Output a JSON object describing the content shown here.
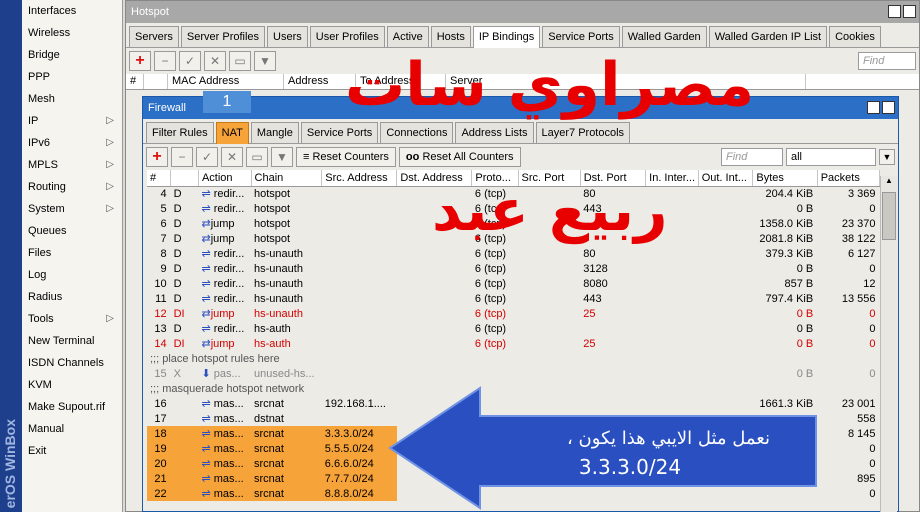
{
  "sidebar": {
    "brand": "erOS WinBox",
    "items": [
      {
        "label": "Interfaces",
        "arrow": false
      },
      {
        "label": "Wireless",
        "arrow": false
      },
      {
        "label": "Bridge",
        "arrow": false
      },
      {
        "label": "PPP",
        "arrow": false
      },
      {
        "label": "Mesh",
        "arrow": false
      },
      {
        "label": "IP",
        "arrow": true
      },
      {
        "label": "IPv6",
        "arrow": true
      },
      {
        "label": "MPLS",
        "arrow": true
      },
      {
        "label": "Routing",
        "arrow": true
      },
      {
        "label": "System",
        "arrow": true
      },
      {
        "label": "Queues",
        "arrow": false
      },
      {
        "label": "Files",
        "arrow": false
      },
      {
        "label": "Log",
        "arrow": false
      },
      {
        "label": "Radius",
        "arrow": false
      },
      {
        "label": "Tools",
        "arrow": true
      },
      {
        "label": "New Terminal",
        "arrow": false
      },
      {
        "label": "ISDN Channels",
        "arrow": false
      },
      {
        "label": "KVM",
        "arrow": false
      },
      {
        "label": "Make Supout.rif",
        "arrow": false
      },
      {
        "label": "Manual",
        "arrow": false
      },
      {
        "label": "Exit",
        "arrow": false
      }
    ]
  },
  "hotspot": {
    "title": "Hotspot",
    "tabs": [
      "Servers",
      "Server Profiles",
      "Users",
      "User Profiles",
      "Active",
      "Hosts",
      "IP Bindings",
      "Service Ports",
      "Walled Garden",
      "Walled Garden IP List",
      "Cookies"
    ],
    "active_tab": "IP Bindings",
    "find_placeholder": "Find",
    "columns": [
      "#",
      "",
      "MAC Address",
      "Address",
      "To Address",
      "Server"
    ]
  },
  "firewall": {
    "title": "Firewall",
    "tabs": [
      "Filter Rules",
      "NAT",
      "Mangle",
      "Service Ports",
      "Connections",
      "Address Lists",
      "Layer7 Protocols"
    ],
    "active_tab": "NAT",
    "reset_counters": "Reset Counters",
    "reset_all": "Reset All Counters",
    "find_placeholder": "Find",
    "filter_value": "all",
    "columns": [
      "#",
      "",
      "Action",
      "Chain",
      "Src. Address",
      "Dst. Address",
      "Proto...",
      "Src. Port",
      "Dst. Port",
      "In. Inter...",
      "Out. Int...",
      "Bytes",
      "Packets"
    ],
    "rows": [
      {
        "num": "4",
        "flag": "D",
        "action": "redir...",
        "chain": "hotspot",
        "src": "",
        "dst": "",
        "proto": "6 (tcp)",
        "sport": "",
        "dport": "80",
        "in": "",
        "out": "",
        "bytes": "204.4 KiB",
        "packets": "3 369",
        "style": ""
      },
      {
        "num": "5",
        "flag": "D",
        "action": "redir...",
        "chain": "hotspot",
        "src": "",
        "dst": "",
        "proto": "6 (tcp)",
        "sport": "",
        "dport": "443",
        "in": "",
        "out": "",
        "bytes": "0 B",
        "packets": "0",
        "style": ""
      },
      {
        "num": "6",
        "flag": "D",
        "action": "jump",
        "chain": "hotspot",
        "src": "",
        "dst": "",
        "proto": "6 (tcp)",
        "sport": "",
        "dport": "",
        "in": "",
        "out": "",
        "bytes": "1358.0 KiB",
        "packets": "23 370",
        "style": ""
      },
      {
        "num": "7",
        "flag": "D",
        "action": "jump",
        "chain": "hotspot",
        "src": "",
        "dst": "",
        "proto": "6 (tcp)",
        "sport": "",
        "dport": "",
        "in": "",
        "out": "",
        "bytes": "2081.8 KiB",
        "packets": "38 122",
        "style": ""
      },
      {
        "num": "8",
        "flag": "D",
        "action": "redir...",
        "chain": "hs-unauth",
        "src": "",
        "dst": "",
        "proto": "6 (tcp)",
        "sport": "",
        "dport": "80",
        "in": "",
        "out": "",
        "bytes": "379.3 KiB",
        "packets": "6 127",
        "style": ""
      },
      {
        "num": "9",
        "flag": "D",
        "action": "redir...",
        "chain": "hs-unauth",
        "src": "",
        "dst": "",
        "proto": "6 (tcp)",
        "sport": "",
        "dport": "3128",
        "in": "",
        "out": "",
        "bytes": "0 B",
        "packets": "0",
        "style": ""
      },
      {
        "num": "10",
        "flag": "D",
        "action": "redir...",
        "chain": "hs-unauth",
        "src": "",
        "dst": "",
        "proto": "6 (tcp)",
        "sport": "",
        "dport": "8080",
        "in": "",
        "out": "",
        "bytes": "857 B",
        "packets": "12",
        "style": ""
      },
      {
        "num": "11",
        "flag": "D",
        "action": "redir...",
        "chain": "hs-unauth",
        "src": "",
        "dst": "",
        "proto": "6 (tcp)",
        "sport": "",
        "dport": "443",
        "in": "",
        "out": "",
        "bytes": "797.4 KiB",
        "packets": "13 556",
        "style": ""
      },
      {
        "num": "12",
        "flag": "DI",
        "action": "jump",
        "chain": "hs-unauth",
        "src": "",
        "dst": "",
        "proto": "6 (tcp)",
        "sport": "",
        "dport": "25",
        "in": "",
        "out": "",
        "bytes": "0 B",
        "packets": "0",
        "style": "red"
      },
      {
        "num": "13",
        "flag": "D",
        "action": "redir...",
        "chain": "hs-auth",
        "src": "",
        "dst": "",
        "proto": "6 (tcp)",
        "sport": "",
        "dport": "",
        "in": "",
        "out": "",
        "bytes": "0 B",
        "packets": "0",
        "style": ""
      },
      {
        "num": "14",
        "flag": "DI",
        "action": "jump",
        "chain": "hs-auth",
        "src": "",
        "dst": "",
        "proto": "6 (tcp)",
        "sport": "",
        "dport": "25",
        "in": "",
        "out": "",
        "bytes": "0 B",
        "packets": "0",
        "style": "red"
      },
      {
        "comment": ";;; place hotspot rules here"
      },
      {
        "num": "15",
        "flag": "X",
        "action": "pas...",
        "chain": "unused-hs...",
        "src": "",
        "dst": "",
        "proto": "",
        "sport": "",
        "dport": "",
        "in": "",
        "out": "",
        "bytes": "0 B",
        "packets": "0",
        "style": "gray"
      },
      {
        "comment": ";;; masquerade hotspot network"
      },
      {
        "num": "16",
        "flag": "",
        "action": "mas...",
        "chain": "srcnat",
        "src": "192.168.1....",
        "dst": "",
        "proto": "",
        "sport": "",
        "dport": "",
        "in": "",
        "out": "",
        "bytes": "1661.3 KiB",
        "packets": "23 001",
        "style": ""
      },
      {
        "num": "17",
        "flag": "",
        "action": "mas...",
        "chain": "dstnat",
        "src": "",
        "dst": "",
        "proto": "",
        "sport": "",
        "dport": "",
        "in": "",
        "out": "",
        "bytes": "",
        "packets": "558",
        "style": ""
      },
      {
        "num": "18",
        "flag": "",
        "action": "mas...",
        "chain": "srcnat",
        "src": "3.3.3.0/24",
        "dst": "",
        "proto": "",
        "sport": "",
        "dport": "",
        "in": "",
        "out": "",
        "bytes": "",
        "packets": "8 145",
        "style": "hl"
      },
      {
        "num": "19",
        "flag": "",
        "action": "mas...",
        "chain": "srcnat",
        "src": "5.5.5.0/24",
        "dst": "",
        "proto": "",
        "sport": "",
        "dport": "",
        "in": "",
        "out": "",
        "bytes": "",
        "packets": "0",
        "style": "hl"
      },
      {
        "num": "20",
        "flag": "",
        "action": "mas...",
        "chain": "srcnat",
        "src": "6.6.6.0/24",
        "dst": "",
        "proto": "",
        "sport": "",
        "dport": "",
        "in": "",
        "out": "",
        "bytes": "",
        "packets": "0",
        "style": "hl"
      },
      {
        "num": "21",
        "flag": "",
        "action": "mas...",
        "chain": "srcnat",
        "src": "7.7.7.0/24",
        "dst": "",
        "proto": "",
        "sport": "",
        "dport": "",
        "in": "",
        "out": "",
        "bytes": "",
        "packets": "895",
        "style": "hl"
      },
      {
        "num": "22",
        "flag": "",
        "action": "mas...",
        "chain": "srcnat",
        "src": "8.8.8.0/24",
        "dst": "",
        "proto": "",
        "sport": "",
        "dport": "",
        "in": "",
        "out": "",
        "bytes": "",
        "packets": "0",
        "style": "hl"
      }
    ]
  },
  "overlay": {
    "badge": "1",
    "headline": "مصراوي سات",
    "signature": "ربيع عبد",
    "annotation_line1": "نعمل مثل الايبي هذا يكون ،",
    "annotation_line2": "3.3.3.0/24",
    "accent": "#2a4fc0"
  }
}
